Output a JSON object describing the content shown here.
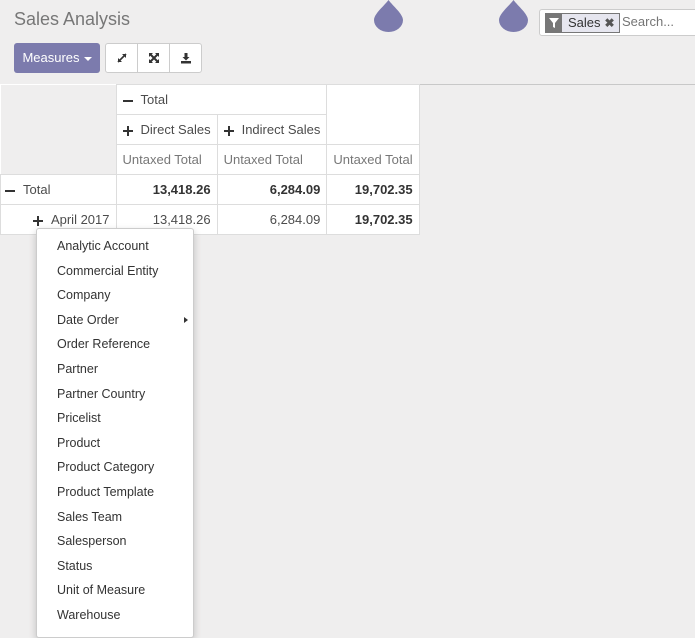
{
  "header": {
    "title": "Sales Analysis",
    "measures_label": "Measures",
    "buttons": [
      "expand-icon",
      "fullscreen-icon",
      "download-icon"
    ]
  },
  "search": {
    "facet_icon": "filter-icon",
    "facet_label": "Sales",
    "facet_remove": "✖",
    "placeholder": "Search..."
  },
  "pivot": {
    "col_total_header": "Total",
    "col_groups": [
      "Direct Sales",
      "Indirect Sales"
    ],
    "measure_label": "Untaxed Total",
    "rows": [
      {
        "label": "Total",
        "values": [
          "13,418.26",
          "6,284.09",
          "19,702.35"
        ],
        "expanded": true
      },
      {
        "label": "April 2017",
        "values": [
          "13,418.26",
          "6,284.09",
          "19,702.35"
        ],
        "expanded": false
      }
    ]
  },
  "groupby_menu": {
    "items": [
      {
        "label": "Analytic Account"
      },
      {
        "label": "Commercial Entity"
      },
      {
        "label": "Company"
      },
      {
        "label": "Date Order",
        "submenu": true
      },
      {
        "label": "Order Reference"
      },
      {
        "label": "Partner"
      },
      {
        "label": "Partner Country"
      },
      {
        "label": "Pricelist"
      },
      {
        "label": "Product"
      },
      {
        "label": "Product Category"
      },
      {
        "label": "Product Template"
      },
      {
        "label": "Sales Team"
      },
      {
        "label": "Salesperson"
      },
      {
        "label": "Status"
      },
      {
        "label": "Unit of Measure"
      },
      {
        "label": "Warehouse"
      }
    ]
  },
  "colors": {
    "accent": "#7c7bad",
    "background": "#efeeee"
  }
}
